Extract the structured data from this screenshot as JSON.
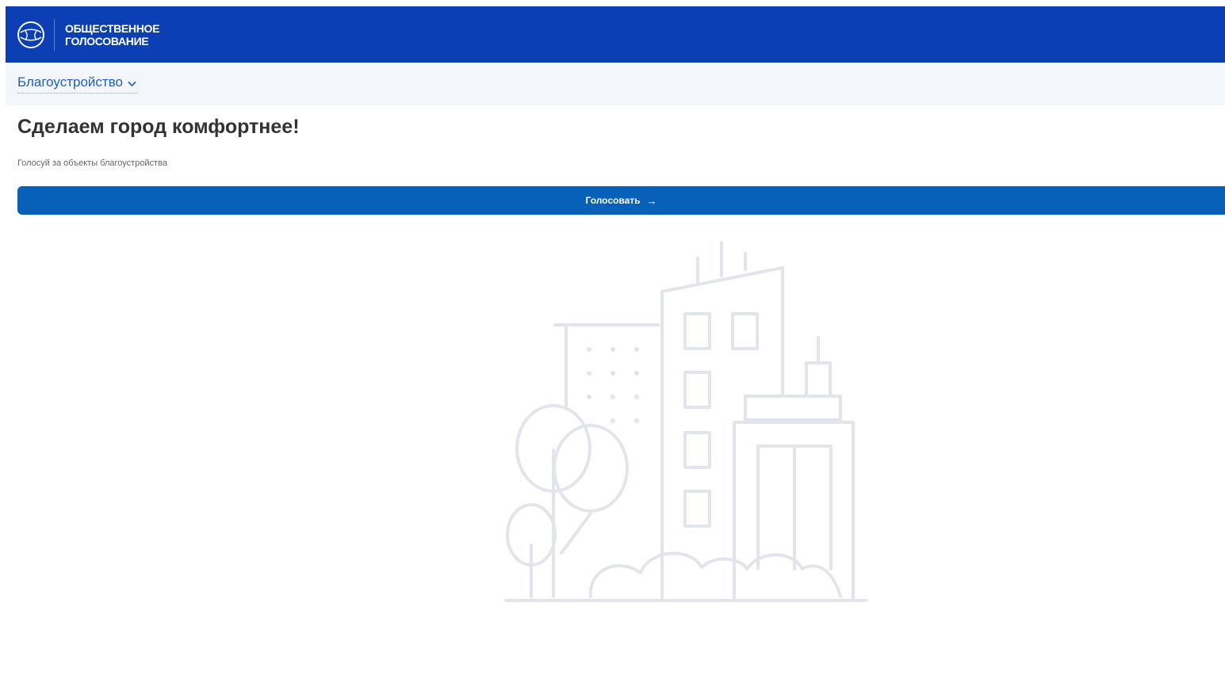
{
  "header": {
    "logo_line1": "ОБЩЕСТВЕННОЕ",
    "logo_line2": "ГОЛОСОВАНИЕ",
    "logo_icon": "globe-icon",
    "bg_color": "#0b3fb3"
  },
  "subnav": {
    "category_label": "Благоустройство",
    "chevron_icon": "chevron-down-icon"
  },
  "main": {
    "title": "Сделаем город комфортнее!",
    "subtitle": "Голосуй за объекты благоустройства",
    "vote_button_label": "Голосовать",
    "vote_button_arrow": "→",
    "button_color": "#0761b8"
  },
  "illustration": {
    "icon": "city-buildings-icon",
    "stroke_color": "#e3e5ec"
  }
}
